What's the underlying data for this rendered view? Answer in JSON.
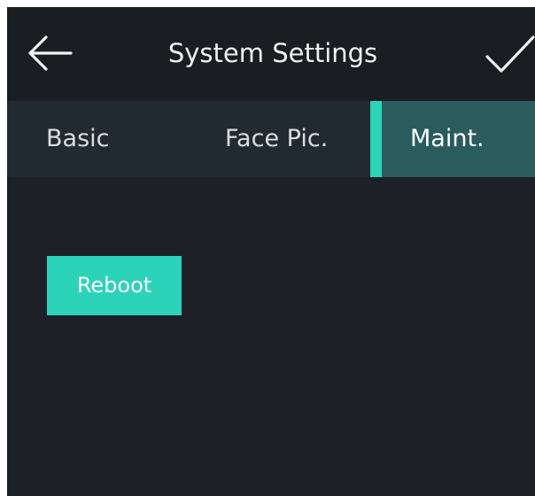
{
  "header": {
    "back_icon": "arrow-left-icon",
    "title": "System Settings",
    "confirm_icon": "checkmark-icon"
  },
  "tabs": [
    {
      "label": "Basic",
      "active": false
    },
    {
      "label": "Face Pic.",
      "active": false
    },
    {
      "label": "Maint.",
      "active": true
    }
  ],
  "main": {
    "reboot_label": "Reboot"
  },
  "colors": {
    "background": "#1d2127",
    "header_bg": "#1a1d21",
    "tab_bar_bg": "#222a31",
    "active_tab_bg": "#2a5c5e",
    "accent": "#2bd3b8",
    "text": "#f2f2f2"
  }
}
